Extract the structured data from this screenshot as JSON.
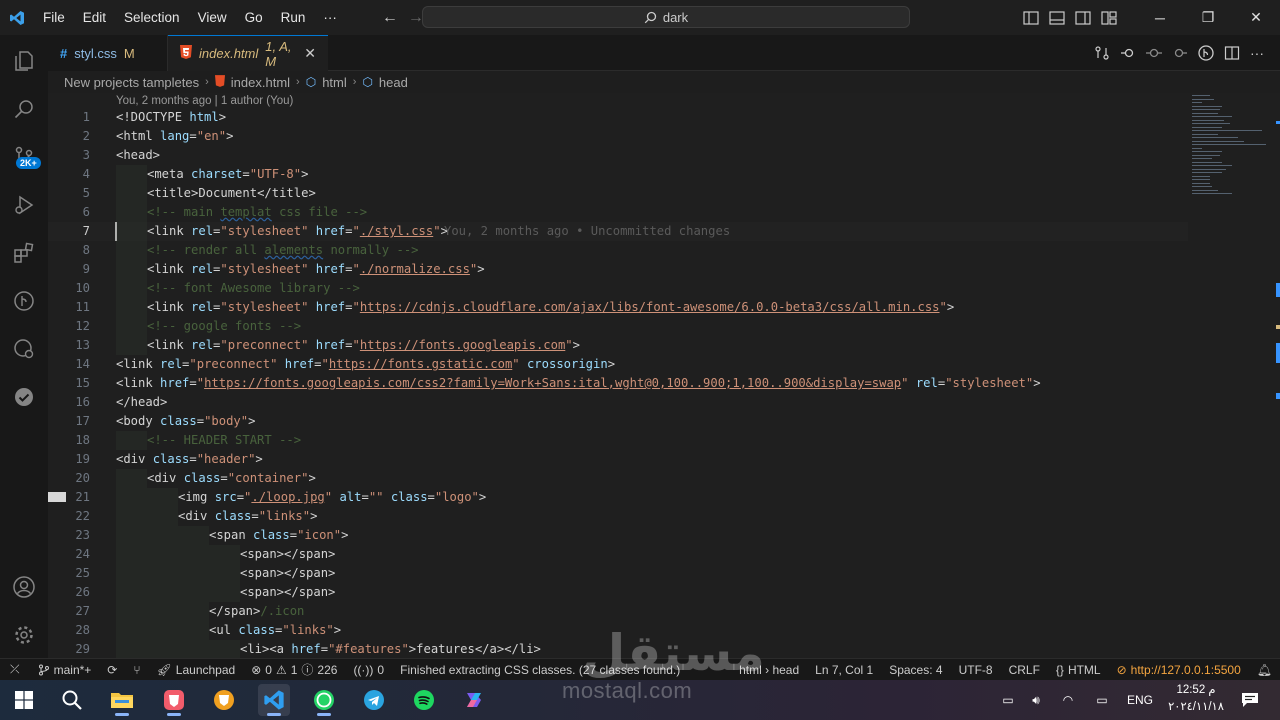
{
  "menu": [
    "File",
    "Edit",
    "Selection",
    "View",
    "Go",
    "Run",
    "···"
  ],
  "command_center": {
    "text": "dark"
  },
  "tabs": [
    {
      "name": "styl.css",
      "status": "M"
    },
    {
      "name": "index.html",
      "status": "1, A, M"
    }
  ],
  "breadcrumb": [
    "New projects tampletes",
    "index.html",
    "html",
    "head"
  ],
  "codelens": "You, 2 months ago | 1 author (You)",
  "editor": {
    "current_line": 7,
    "blame": "You, 2 months ago • Uncommitted changes",
    "lines": [
      {
        "n": "1",
        "indent": 0,
        "t": [
          [
            "tg",
            "<!DOCTYPE "
          ],
          [
            "an",
            "html"
          ],
          [
            "tg",
            ">"
          ]
        ]
      },
      {
        "n": "2",
        "indent": 0,
        "t": [
          [
            "tg",
            "<html "
          ],
          [
            "an",
            "lang"
          ],
          [
            "tg",
            "="
          ],
          [
            "av",
            "\"en\""
          ],
          [
            "tg",
            ">"
          ]
        ]
      },
      {
        "n": "3",
        "indent": 0,
        "t": [
          [
            "tg",
            "<head>"
          ]
        ]
      },
      {
        "n": "4",
        "indent": 1,
        "t": [
          [
            "tg",
            "<meta "
          ],
          [
            "an",
            "charset"
          ],
          [
            "tg",
            "="
          ],
          [
            "av",
            "\"UTF-8\""
          ],
          [
            "tg",
            ">"
          ]
        ]
      },
      {
        "n": "5",
        "indent": 1,
        "t": [
          [
            "tg",
            "<title>"
          ],
          [
            "tn",
            "Document"
          ],
          [
            "tg",
            "</title>"
          ]
        ]
      },
      {
        "n": "6",
        "indent": 1,
        "t": [
          [
            "cm",
            "<!-- main "
          ],
          [
            "cm sq",
            "templat"
          ],
          [
            "cm",
            " css file -->"
          ]
        ]
      },
      {
        "n": "7",
        "indent": 1,
        "t": [
          [
            "tg",
            "<link "
          ],
          [
            "an",
            "rel"
          ],
          [
            "tg",
            "="
          ],
          [
            "av",
            "\"stylesheet\""
          ],
          [
            "tg",
            " "
          ],
          [
            "an",
            "href"
          ],
          [
            "tg",
            "="
          ],
          [
            "av",
            "\""
          ],
          [
            "av url",
            "./styl.css"
          ],
          [
            "av",
            "\""
          ],
          [
            "tg",
            ">"
          ]
        ]
      },
      {
        "n": "8",
        "indent": 1,
        "t": [
          [
            "cm",
            "<!-- render all "
          ],
          [
            "cm sq",
            "alements"
          ],
          [
            "cm",
            " normally -->"
          ]
        ]
      },
      {
        "n": "9",
        "indent": 1,
        "t": [
          [
            "tg",
            "<link "
          ],
          [
            "an",
            "rel"
          ],
          [
            "tg",
            "="
          ],
          [
            "av",
            "\"stylesheet\""
          ],
          [
            "tg",
            " "
          ],
          [
            "an",
            "href"
          ],
          [
            "tg",
            "="
          ],
          [
            "av",
            "\""
          ],
          [
            "av url",
            "./normalize.css"
          ],
          [
            "av",
            "\""
          ],
          [
            "tg",
            ">"
          ]
        ]
      },
      {
        "n": "10",
        "indent": 1,
        "t": [
          [
            "cm",
            "<!-- font Awesome library -->"
          ]
        ]
      },
      {
        "n": "11",
        "indent": 1,
        "t": [
          [
            "tg",
            "<link "
          ],
          [
            "an",
            "rel"
          ],
          [
            "tg",
            "="
          ],
          [
            "av",
            "\"stylesheet\""
          ],
          [
            "tg",
            " "
          ],
          [
            "an",
            "href"
          ],
          [
            "tg",
            "="
          ],
          [
            "av",
            "\""
          ],
          [
            "av url",
            "https://cdnjs.cloudflare.com/ajax/libs/font-awesome/6.0.0-beta3/css/all.min.css"
          ],
          [
            "av",
            "\""
          ],
          [
            "tg",
            ">"
          ]
        ]
      },
      {
        "n": "12",
        "indent": 1,
        "t": [
          [
            "cm",
            "<!-- google fonts -->"
          ]
        ]
      },
      {
        "n": "13",
        "indent": 1,
        "t": [
          [
            "tg",
            "<link "
          ],
          [
            "an",
            "rel"
          ],
          [
            "tg",
            "="
          ],
          [
            "av",
            "\"preconnect\""
          ],
          [
            "tg",
            " "
          ],
          [
            "an",
            "href"
          ],
          [
            "tg",
            "="
          ],
          [
            "av",
            "\""
          ],
          [
            "av url",
            "https://fonts.googleapis.com"
          ],
          [
            "av",
            "\""
          ],
          [
            "tg",
            ">"
          ]
        ]
      },
      {
        "n": "14",
        "indent": 0,
        "t": [
          [
            "tg",
            "<link "
          ],
          [
            "an",
            "rel"
          ],
          [
            "tg",
            "="
          ],
          [
            "av",
            "\"preconnect\""
          ],
          [
            "tg",
            " "
          ],
          [
            "an",
            "href"
          ],
          [
            "tg",
            "="
          ],
          [
            "av",
            "\""
          ],
          [
            "av url",
            "https://fonts.gstatic.com"
          ],
          [
            "av",
            "\""
          ],
          [
            "tg",
            " "
          ],
          [
            "an",
            "crossorigin"
          ],
          [
            "tg",
            ">"
          ]
        ]
      },
      {
        "n": "15",
        "indent": 0,
        "t": [
          [
            "tg",
            "<link "
          ],
          [
            "an",
            "href"
          ],
          [
            "tg",
            "="
          ],
          [
            "av",
            "\""
          ],
          [
            "av url",
            "https://fonts.googleapis.com/css2?family=Work+Sans:ital,wght@0,100..900;1,100..900&display=swap"
          ],
          [
            "av",
            "\""
          ],
          [
            "tg",
            " "
          ],
          [
            "an",
            "rel"
          ],
          [
            "tg",
            "="
          ],
          [
            "av",
            "\"stylesheet\""
          ],
          [
            "tg",
            ">"
          ]
        ]
      },
      {
        "n": "16",
        "indent": 0,
        "t": [
          [
            "tg",
            "</head>"
          ]
        ]
      },
      {
        "n": "17",
        "indent": 0,
        "t": [
          [
            "tg",
            "<body "
          ],
          [
            "an",
            "class"
          ],
          [
            "tg",
            "="
          ],
          [
            "av",
            "\"body\""
          ],
          [
            "tg",
            ">"
          ]
        ]
      },
      {
        "n": "18",
        "indent": 1,
        "t": [
          [
            "cm",
            "<!-- HEADER START -->"
          ]
        ]
      },
      {
        "n": "19",
        "indent": 0,
        "t": [
          [
            "tg",
            "<div "
          ],
          [
            "an",
            "class"
          ],
          [
            "tg",
            "="
          ],
          [
            "av",
            "\"header\""
          ],
          [
            "tg",
            ">"
          ]
        ]
      },
      {
        "n": "20",
        "indent": 1,
        "t": [
          [
            "tg",
            "<div "
          ],
          [
            "an",
            "class"
          ],
          [
            "tg",
            "="
          ],
          [
            "av",
            "\"container\""
          ],
          [
            "tg",
            ">"
          ]
        ]
      },
      {
        "n": "21",
        "indent": 2,
        "t": [
          [
            "tg",
            "<img "
          ],
          [
            "an",
            "src"
          ],
          [
            "tg",
            "="
          ],
          [
            "av",
            "\""
          ],
          [
            "av url",
            "./loop.jpg"
          ],
          [
            "av",
            "\""
          ],
          [
            "tg",
            " "
          ],
          [
            "an",
            "alt"
          ],
          [
            "tg",
            "="
          ],
          [
            "av",
            "\"\""
          ],
          [
            "tg",
            " "
          ],
          [
            "an",
            "class"
          ],
          [
            "tg",
            "="
          ],
          [
            "av",
            "\"logo\""
          ],
          [
            "tg",
            ">"
          ]
        ]
      },
      {
        "n": "22",
        "indent": 2,
        "t": [
          [
            "tg",
            "<div "
          ],
          [
            "an",
            "class"
          ],
          [
            "tg",
            "="
          ],
          [
            "av",
            "\"links\""
          ],
          [
            "tg",
            ">"
          ]
        ]
      },
      {
        "n": "23",
        "indent": 3,
        "t": [
          [
            "tg",
            "<span "
          ],
          [
            "an",
            "class"
          ],
          [
            "tg",
            "="
          ],
          [
            "av",
            "\"icon\""
          ],
          [
            "tg",
            ">"
          ]
        ]
      },
      {
        "n": "24",
        "indent": 4,
        "t": [
          [
            "tg",
            "<span></span>"
          ]
        ]
      },
      {
        "n": "25",
        "indent": 4,
        "t": [
          [
            "tg",
            "<span></span>"
          ]
        ]
      },
      {
        "n": "26",
        "indent": 4,
        "t": [
          [
            "tg",
            "<span></span>"
          ]
        ]
      },
      {
        "n": "27",
        "indent": 3,
        "t": [
          [
            "tg",
            "</span>"
          ],
          [
            "cm",
            "/.icon"
          ]
        ]
      },
      {
        "n": "28",
        "indent": 3,
        "t": [
          [
            "tg",
            "<ul "
          ],
          [
            "an",
            "class"
          ],
          [
            "tg",
            "="
          ],
          [
            "av",
            "\"links\""
          ],
          [
            "tg",
            ">"
          ]
        ]
      },
      {
        "n": "29",
        "indent": 4,
        "t": [
          [
            "tg",
            "<li><a "
          ],
          [
            "an",
            "href"
          ],
          [
            "tg",
            "="
          ],
          [
            "av",
            "\"#features\""
          ],
          [
            "tg",
            ">"
          ],
          [
            "tn",
            "features"
          ],
          [
            "tg",
            "</a></li>"
          ]
        ]
      }
    ]
  },
  "statusbar": {
    "branch": "main*+",
    "launchpad": "Launchpad",
    "errors": "0",
    "warnings": "1",
    "info": "226",
    "ports": "0",
    "message": "Finished extracting CSS classes. (27 classes found.)",
    "path": "html › head",
    "position": "Ln 7, Col 1",
    "spaces": "Spaces: 4",
    "encoding": "UTF-8",
    "eol": "CRLF",
    "language": "HTML",
    "server": "http://127.0.0.1:5500"
  },
  "taskbar": {
    "lang": "ENG",
    "time": "12:52 م",
    "date": "٢٠٢٤/١١/١٨"
  },
  "activity_badge": "2K+",
  "watermark": {
    "ar": "مستقل",
    "en": "mostaql.com"
  },
  "colors": {
    "accent": "#0078d4",
    "tag": "#d4d4d4",
    "attr": "#9cdcfe",
    "string": "#ce9178",
    "comment": "#6a9955",
    "server": "#f4a540"
  }
}
